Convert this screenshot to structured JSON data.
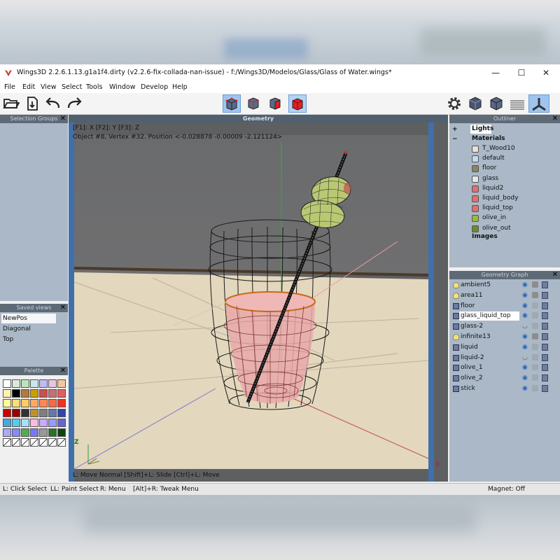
{
  "window": {
    "title": "Wings3D 2.2.6.1.13.g1a1f4.dirty (v2.2.6-fix-collada-nan-issue) - f:/Wings3D/Modelos/Glass/Glass of Water.wings*",
    "minimize": "—",
    "maximize": "☐",
    "close": "✕"
  },
  "menu": [
    "File",
    "Edit",
    "View",
    "Select",
    "Tools",
    "Window",
    "Develop",
    "Help"
  ],
  "panels": {
    "selection_groups": "Selection Groups",
    "saved_views": "Saved views",
    "saved_view_items": [
      "NewPos",
      "Diagonal",
      "Top"
    ],
    "palette": "Palette",
    "geometry": "Geometry",
    "outliner": "Outliner",
    "geometry_graph": "Geometry Graph"
  },
  "viewport": {
    "axis_hint": "[F1]: X    [F2]: Y    [F3]: Z",
    "info": "Object #8, Vertex #32. Position <-0.028878  -0.00009  -2.121124>",
    "hint_bottom": "L: Move Normal     [Shift]+L: Slide      [Ctrl]+L: Move",
    "z_label": "Z",
    "x_label": "X"
  },
  "outliner": {
    "lights": "Lights",
    "materials": "Materials",
    "images": "Images",
    "expand_plus": "+",
    "expand_minus": "−",
    "material_items": [
      {
        "name": "T_Wood10",
        "color": "#e6e2d8"
      },
      {
        "name": "default",
        "color": "#c9d9f2"
      },
      {
        "name": "floor",
        "color": "#8d8363"
      },
      {
        "name": "glass",
        "color": "#e4e8ec"
      },
      {
        "name": "liquid2",
        "color": "#e07070"
      },
      {
        "name": "liquid_body",
        "color": "#e07070"
      },
      {
        "name": "liquid_top",
        "color": "#e07070"
      },
      {
        "name": "olive_in",
        "color": "#9bbb3a"
      },
      {
        "name": "olive_out",
        "color": "#6f8a2c"
      }
    ]
  },
  "geometry_graph": [
    {
      "name": "ambient5",
      "kind": "light"
    },
    {
      "name": "area11",
      "kind": "light"
    },
    {
      "name": "floor",
      "kind": "object"
    },
    {
      "name": "glass_liquid_top",
      "kind": "object",
      "selected": true
    },
    {
      "name": "glass-2",
      "kind": "object",
      "hidden": true
    },
    {
      "name": "infinite13",
      "kind": "light"
    },
    {
      "name": "liquid",
      "kind": "object"
    },
    {
      "name": "liquid-2",
      "kind": "object",
      "hidden": true
    },
    {
      "name": "olive_1",
      "kind": "object"
    },
    {
      "name": "olive_2",
      "kind": "object"
    },
    {
      "name": "stick",
      "kind": "object"
    }
  ],
  "statusbar": {
    "left1": "L: Click Select",
    "left2": "LL: Paint Select",
    "left3": "R: Menu",
    "left4": "[Alt]+R: Tweak Menu",
    "magnet": "Magnet: Off"
  },
  "palette_colors": [
    "#ffffff",
    "#d8ebdc",
    "#b8e6b8",
    "#c8e6ee",
    "#bdbdf0",
    "#e6c6e6",
    "#f2c6a0",
    "#fff0b0",
    "#000000",
    "#b07a40",
    "#c8a000",
    "#c85050",
    "#c87070",
    "#e06060",
    "#ffff99",
    "#ffdd77",
    "#ffcc66",
    "#ffaa66",
    "#ff8855",
    "#ff6644",
    "#ee3322",
    "#cc0000",
    "#990000",
    "#333333",
    "#c09030",
    "#7f7f7f",
    "#6677aa",
    "#3344aa",
    "#44aadd",
    "#55ccee",
    "#aaddff",
    "#ffbbdd",
    "#ccaaff",
    "#9999ff",
    "#6666cc",
    "#aaaaff",
    "#8888ff",
    "#55aa55",
    "#7777ff",
    "#999999",
    "#227722",
    "#114411",
    "#77cc55",
    "#55bb44",
    "#aaccee",
    "#ccccff",
    "#ffffff",
    "#ffffff",
    "#ffffff"
  ]
}
